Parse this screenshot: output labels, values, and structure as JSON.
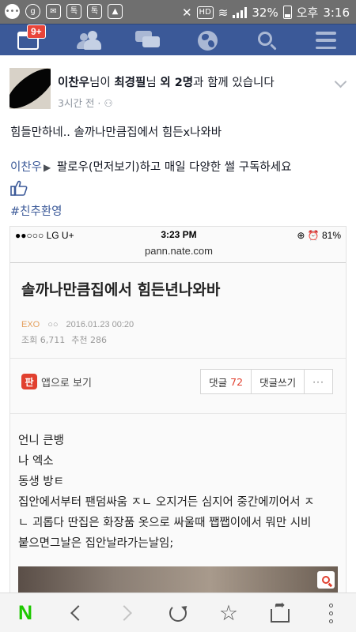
{
  "status_bar": {
    "battery": "32%",
    "period": "오후",
    "time": "3:16",
    "hd_badge": "HD",
    "icons": [
      "message-icon",
      "g-circle-icon",
      "mail-icon",
      "talk-icon",
      "talk-icon",
      "gallery-icon",
      "mute-icon",
      "hd-icon",
      "wifi-icon",
      "signal-icon",
      "battery-icon"
    ]
  },
  "nav": {
    "notification_badge": "9+",
    "icons": [
      "news-feed-icon",
      "friends-icon",
      "messages-icon",
      "globe-icon",
      "search-icon",
      "menu-icon"
    ]
  },
  "post": {
    "author": "이찬우",
    "title_suffix_1": "님이 ",
    "tagged": "최경필",
    "title_suffix_2": "님 ",
    "others": "외 2명",
    "title_suffix_3": "과 함께 있습니다",
    "time": "3시간 전 · ",
    "text_line": "힘들만하네.. 솔까나만큼집에서 힘든x나와바",
    "promo_name": "이찬우",
    "promo_arrow": "▶",
    "promo_text": " 팔로우(먼저보기)하고 매일 다양한 썰 구독하세요",
    "hashtag": "#친추환영"
  },
  "screenshot": {
    "carrier": "●●○○○ LG U+",
    "time": "3:23 PM",
    "battery": "⊕ ⏰ 81%",
    "url": "pann.nate.com",
    "article_title": "솔까나만큼집에서 힘든년나와바",
    "category": "EXO",
    "author_masked": "○○",
    "date": "2016.01.23 00:20",
    "views": "조회 6,711",
    "recommend": "추천 286",
    "app_icon_text": "판",
    "app_view": "앱으로 보기",
    "comments_label": "댓글",
    "comments_count": "72",
    "write_comment": "댓글쓰기",
    "more": "···",
    "body_lines": [
      "언니 큰뱅",
      "나 엑소",
      "동생 방ㅌ",
      "집안에서부터 팬덤싸움 ㅈㄴ 오지거든 심지어 중간에끼어서 ㅈ",
      "ㄴ 괴롭다 딴집은 화장품 옷으로 싸울때 쨉쨉이에서 뭐만 시비",
      "붙으면그날은 집안날라가는날임;"
    ]
  },
  "bottom_bar": {
    "home_label": "N",
    "icons": [
      "naver-home-icon",
      "back-icon",
      "forward-icon",
      "refresh-icon",
      "bookmark-star-icon",
      "share-icon",
      "more-icon"
    ]
  }
}
